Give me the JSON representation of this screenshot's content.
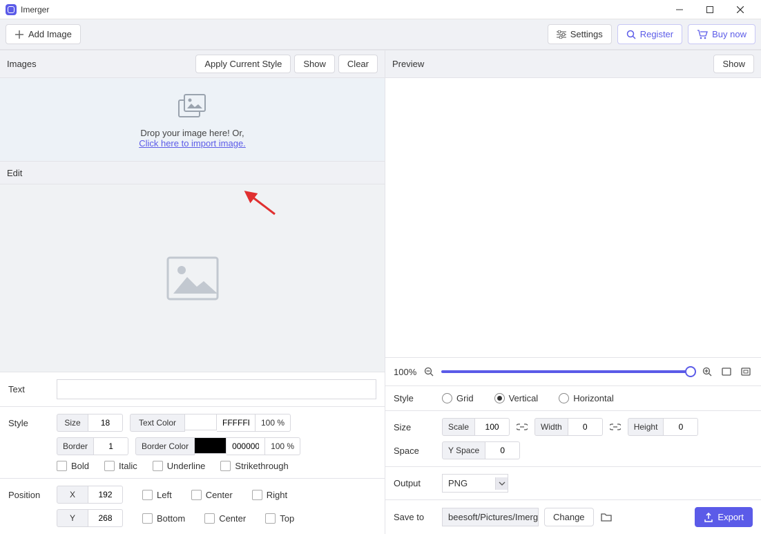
{
  "app": {
    "title": "Imerger"
  },
  "toolbar": {
    "add_image": "Add Image",
    "settings": "Settings",
    "register": "Register",
    "buy_now": "Buy now"
  },
  "images_panel": {
    "title": "Images",
    "apply_style": "Apply Current Style",
    "show": "Show",
    "clear": "Clear",
    "drop_text": "Drop your image here! Or,",
    "drop_link": "Click here to import image."
  },
  "edit_panel": {
    "title": "Edit"
  },
  "text": {
    "label": "Text",
    "value": ""
  },
  "style": {
    "label": "Style",
    "size_label": "Size",
    "size": "18",
    "text_color_label": "Text Color",
    "text_color": "FFFFFF",
    "text_opacity": "100 %",
    "border_label": "Border",
    "border": "1",
    "border_color_label": "Border Color",
    "border_color": "000000",
    "border_opacity": "100 %",
    "bold": "Bold",
    "italic": "Italic",
    "underline": "Underline",
    "strike": "Strikethrough"
  },
  "position": {
    "label": "Position",
    "x_label": "X",
    "x": "192",
    "y_label": "Y",
    "y": "268",
    "left": "Left",
    "center": "Center",
    "right": "Right",
    "bottom": "Bottom",
    "top": "Top"
  },
  "preview": {
    "title": "Preview",
    "show": "Show"
  },
  "zoom": {
    "value": "100%"
  },
  "right_style": {
    "label": "Style",
    "grid": "Grid",
    "vertical": "Vertical",
    "horizontal": "Horizontal",
    "selected": "vertical"
  },
  "size": {
    "label": "Size",
    "scale_label": "Scale",
    "scale": "100",
    "width_label": "Width",
    "width": "0",
    "height_label": "Height",
    "height": "0"
  },
  "space": {
    "label": "Space",
    "y_label": "Y Space",
    "y": "0"
  },
  "output": {
    "label": "Output",
    "format": "PNG"
  },
  "save": {
    "label": "Save to",
    "path": "beesoft/Pictures/Imerger",
    "change": "Change",
    "export": "Export"
  }
}
